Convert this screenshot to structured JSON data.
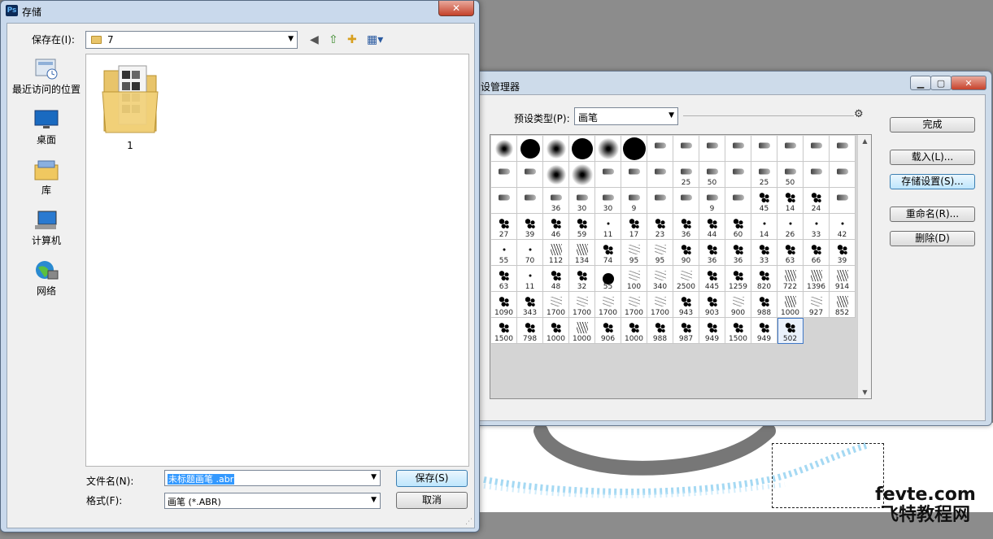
{
  "watermark": {
    "line1": "fevte.com",
    "line2": "飞特教程网"
  },
  "preset_manager": {
    "title": "设管理器",
    "preset_type_label": "预设类型(P):",
    "preset_type_value": "画笔",
    "buttons": {
      "done": "完成",
      "load": "载入(L)...",
      "save_set": "存储设置(S)...",
      "rename": "重命名(R)...",
      "delete": "删除(D)"
    },
    "brushes": [
      {
        "n": "",
        "s": "fuzzy",
        "z": 22
      },
      {
        "n": "",
        "s": "hard",
        "z": 24
      },
      {
        "n": "",
        "s": "fuzzy",
        "z": 24
      },
      {
        "n": "",
        "s": "hard",
        "z": 26
      },
      {
        "n": "",
        "s": "fuzzy",
        "z": 26
      },
      {
        "n": "",
        "s": "hard",
        "z": 28
      },
      {
        "n": "",
        "s": "tip"
      },
      {
        "n": "",
        "s": "tip"
      },
      {
        "n": "",
        "s": "tip"
      },
      {
        "n": "",
        "s": "tip"
      },
      {
        "n": "",
        "s": "tip"
      },
      {
        "n": "",
        "s": "tip"
      },
      {
        "n": "",
        "s": "tip"
      },
      {
        "n": "",
        "s": "tip"
      },
      {
        "n": "",
        "s": "tip"
      },
      {
        "n": "",
        "s": "tip"
      },
      {
        "n": "",
        "s": "fuzzy",
        "z": 24
      },
      {
        "n": "",
        "s": "fuzzy",
        "z": 26
      },
      {
        "n": "",
        "s": "tip"
      },
      {
        "n": "",
        "s": "tip"
      },
      {
        "n": "",
        "s": "tip"
      },
      {
        "n": "25",
        "s": "tip"
      },
      {
        "n": "50",
        "s": "tip"
      },
      {
        "n": "",
        "s": "tip"
      },
      {
        "n": "25",
        "s": "tip"
      },
      {
        "n": "50",
        "s": "tip"
      },
      {
        "n": "",
        "s": "tip"
      },
      {
        "n": "",
        "s": "tip"
      },
      {
        "n": "",
        "s": "tip"
      },
      {
        "n": "",
        "s": "tip"
      },
      {
        "n": "36",
        "s": "tip"
      },
      {
        "n": "30",
        "s": "tip"
      },
      {
        "n": "30",
        "s": "tip"
      },
      {
        "n": "9",
        "s": "tip"
      },
      {
        "n": "",
        "s": "tip"
      },
      {
        "n": "",
        "s": "tip"
      },
      {
        "n": "9",
        "s": "tip"
      },
      {
        "n": "",
        "s": "tip"
      },
      {
        "n": "45",
        "s": "splat"
      },
      {
        "n": "14",
        "s": "splat"
      },
      {
        "n": "24",
        "s": "splat"
      },
      {
        "n": "",
        "s": "tip"
      },
      {
        "n": "27",
        "s": "splat"
      },
      {
        "n": "39",
        "s": "splat"
      },
      {
        "n": "46",
        "s": "splat"
      },
      {
        "n": "59",
        "s": "splat"
      },
      {
        "n": "11",
        "s": "dot"
      },
      {
        "n": "17",
        "s": "splat"
      },
      {
        "n": "23",
        "s": "splat"
      },
      {
        "n": "36",
        "s": "splat"
      },
      {
        "n": "44",
        "s": "splat"
      },
      {
        "n": "60",
        "s": "splat"
      },
      {
        "n": "14",
        "s": "dot"
      },
      {
        "n": "26",
        "s": "dot"
      },
      {
        "n": "33",
        "s": "dot"
      },
      {
        "n": "42",
        "s": "dot"
      },
      {
        "n": "55",
        "s": "dot"
      },
      {
        "n": "70",
        "s": "dot"
      },
      {
        "n": "112",
        "s": "grass"
      },
      {
        "n": "134",
        "s": "grass"
      },
      {
        "n": "74",
        "s": "splat"
      },
      {
        "n": "95",
        "s": "light"
      },
      {
        "n": "95",
        "s": "light"
      },
      {
        "n": "90",
        "s": "splat"
      },
      {
        "n": "36",
        "s": "splat"
      },
      {
        "n": "36",
        "s": "splat"
      },
      {
        "n": "33",
        "s": "splat"
      },
      {
        "n": "63",
        "s": "splat"
      },
      {
        "n": "66",
        "s": "splat"
      },
      {
        "n": "39",
        "s": "splat"
      },
      {
        "n": "63",
        "s": "splat"
      },
      {
        "n": "11",
        "s": "dot"
      },
      {
        "n": "48",
        "s": "splat"
      },
      {
        "n": "32",
        "s": "splat"
      },
      {
        "n": "55",
        "s": "hard",
        "z": 14
      },
      {
        "n": "100",
        "s": "light"
      },
      {
        "n": "340",
        "s": "light"
      },
      {
        "n": "2500",
        "s": "light"
      },
      {
        "n": "445",
        "s": "splat"
      },
      {
        "n": "1259",
        "s": "splat"
      },
      {
        "n": "820",
        "s": "splat"
      },
      {
        "n": "722",
        "s": "grass"
      },
      {
        "n": "1396",
        "s": "grass"
      },
      {
        "n": "914",
        "s": "grass"
      },
      {
        "n": "1090",
        "s": "splat"
      },
      {
        "n": "343",
        "s": "splat"
      },
      {
        "n": "1700",
        "s": "light"
      },
      {
        "n": "1700",
        "s": "light"
      },
      {
        "n": "1700",
        "s": "light"
      },
      {
        "n": "1700",
        "s": "light"
      },
      {
        "n": "1700",
        "s": "light"
      },
      {
        "n": "943",
        "s": "splat"
      },
      {
        "n": "903",
        "s": "splat"
      },
      {
        "n": "900",
        "s": "light"
      },
      {
        "n": "988",
        "s": "splat"
      },
      {
        "n": "1000",
        "s": "grass"
      },
      {
        "n": "927",
        "s": "light"
      },
      {
        "n": "852",
        "s": "grass"
      },
      {
        "n": "1500",
        "s": "splat"
      },
      {
        "n": "798",
        "s": "splat"
      },
      {
        "n": "1000",
        "s": "splat"
      },
      {
        "n": "1000",
        "s": "grass"
      },
      {
        "n": "906",
        "s": "splat"
      },
      {
        "n": "1000",
        "s": "splat"
      },
      {
        "n": "988",
        "s": "splat"
      },
      {
        "n": "987",
        "s": "splat"
      },
      {
        "n": "949",
        "s": "splat"
      },
      {
        "n": "1500",
        "s": "splat"
      },
      {
        "n": "949",
        "s": "splat"
      },
      {
        "n": "502",
        "s": "splat",
        "sel": true
      }
    ]
  },
  "save_dialog": {
    "title": "存储",
    "close": "✕",
    "save_in_label": "保存在(I):",
    "folder": "7",
    "places": [
      "最近访问的位置",
      "桌面",
      "库",
      "计算机",
      "网络"
    ],
    "files": [
      {
        "name": "1"
      }
    ],
    "file_name_label": "文件名(N):",
    "file_name_value": "未标题画笔 .abr",
    "format_label": "格式(F):",
    "format_value": "画笔 (*.ABR)",
    "save_button": "保存(S)",
    "cancel_button": "取消"
  }
}
